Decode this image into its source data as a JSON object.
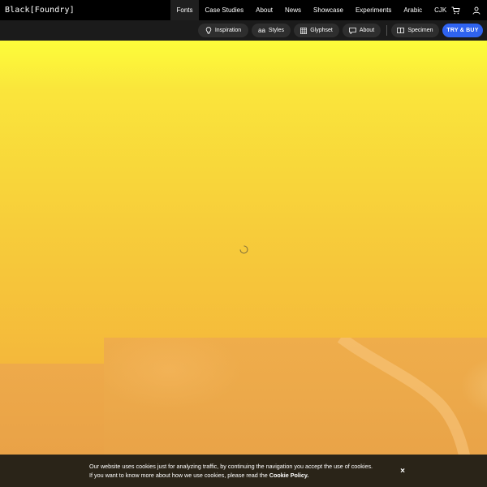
{
  "brand": {
    "logo": "Black[Foundry]"
  },
  "nav": {
    "links": [
      "Fonts",
      "Case Studies",
      "About",
      "News",
      "Showcase",
      "Experiments",
      "Arabic",
      "CJK"
    ],
    "active_index": 0,
    "icons": [
      "cart-icon",
      "user-icon"
    ]
  },
  "toolbar": {
    "inspiration": "Inspiration",
    "styles": "Styles",
    "styles_glyph": "aa",
    "glyphset": "Glyphset",
    "about": "About",
    "specimen": "Specimen",
    "try_buy": "TRY & BUY"
  },
  "cookie": {
    "line1": "Our website uses cookies just for analyzing traffic, by continuing the navigation you accept the use of cookies.",
    "line2": "If you want to know more about how we use cookies, please read the",
    "link": "Cookie Policy.",
    "close": "×"
  },
  "colors": {
    "accent": "#2f63f0",
    "nav_bg": "#000000",
    "toolbar_bg": "#1b1b1b",
    "hero_top": "#fdfd3a",
    "hero_bottom": "#f2ab3c",
    "cookie_bg": "#2a2418"
  }
}
